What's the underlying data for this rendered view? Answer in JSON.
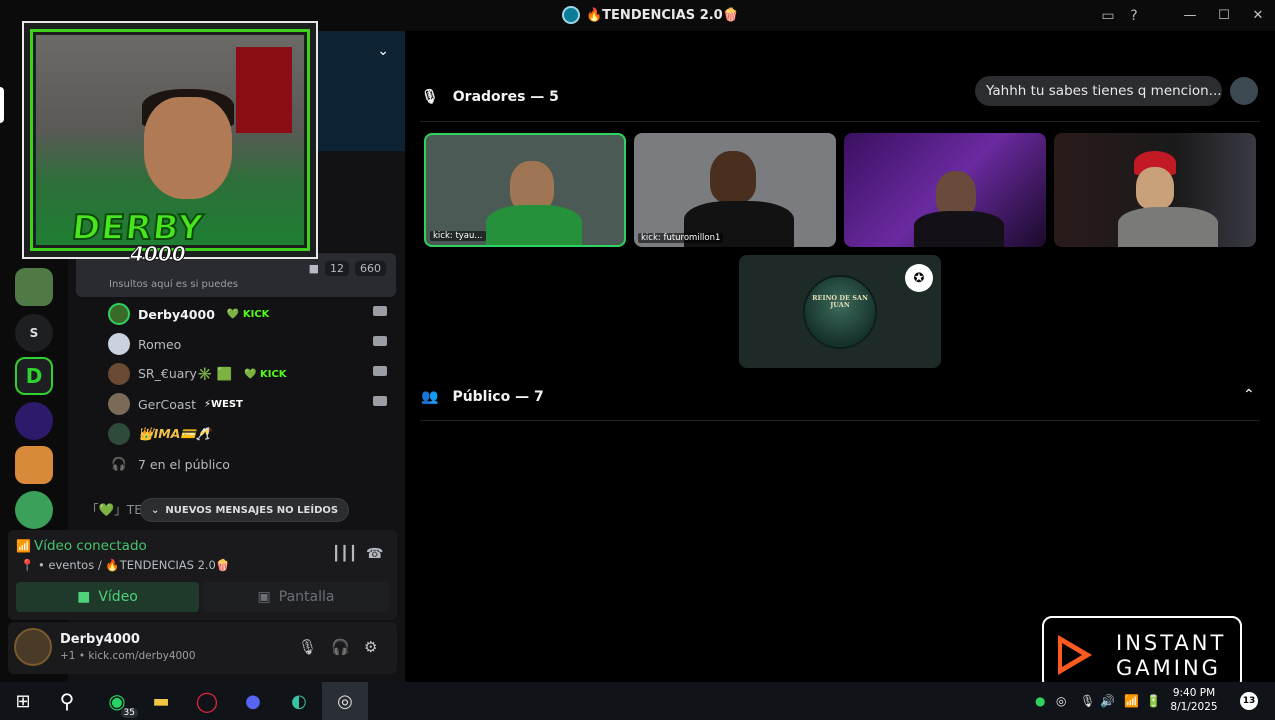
{
  "window": {
    "title": "🔥TENDENCIAS 2.0🍿",
    "controls": {
      "minimize": "—",
      "maximize": "☐",
      "close": "✕"
    }
  },
  "sidebar": {
    "voice_channel": {
      "counts": {
        "video": "12",
        "members": "660"
      },
      "subtitle": "Insultos aquí es si puedes"
    },
    "members": [
      {
        "name": "Derby4000",
        "badge": "KICK",
        "avatar_color": "#3a6a2a"
      },
      {
        "name": "Romeo",
        "badge": "",
        "avatar_color": "#c9d3df"
      },
      {
        "name": "SR_€uary✳️ 🟩",
        "badge": "KICK",
        "avatar_color": "#6a4a32"
      },
      {
        "name": "GerCoast",
        "badge": "⚡WEST",
        "avatar_color": "#7a6a58"
      },
      {
        "name": "👑IMA💳🥂",
        "badge": "",
        "avatar_color": "#2e4a3a"
      }
    ],
    "audience_link": "7 en el público",
    "next_channel_prefix": "「💚」TE",
    "unread_pill": "NUEVOS MENSAJES NO LEÍDOS"
  },
  "voice_panel": {
    "status": "Vídeo conectado",
    "location": "eventos / 🔥TENDENCIAS 2.0🍿",
    "video_button": "Vídeo",
    "screen_button": "Pantalla"
  },
  "user_panel": {
    "name": "Derby4000",
    "sub": "+1 • kick.com/derby4000"
  },
  "overlay": {
    "logo_top": "DERBY",
    "logo_bottom": "4000"
  },
  "stage": {
    "speakers_header": "Oradores — 5",
    "audience_header": "Público — 7",
    "chat_bubble": "Yahhh tu sabes tienes q mencion...",
    "tiles": [
      {
        "label": "kick: tyau...",
        "speaking": true
      },
      {
        "label": "kick: futuromillon1",
        "speaking": false
      },
      {
        "label": "",
        "speaking": false
      },
      {
        "label": "",
        "speaking": false
      }
    ],
    "empty_tile_badge": "REINO DE SAN JUAN"
  },
  "ad": {
    "line1": "INSTANT",
    "line2": "GAMING"
  },
  "taskbar": {
    "whatsapp_badge": "35",
    "time": "9:40 PM",
    "date": "8/1/2025",
    "notifications": "13"
  },
  "colors": {
    "accent_green": "#2fd160",
    "kick_green": "#53fc18",
    "ig_orange": "#ff5a1f"
  }
}
